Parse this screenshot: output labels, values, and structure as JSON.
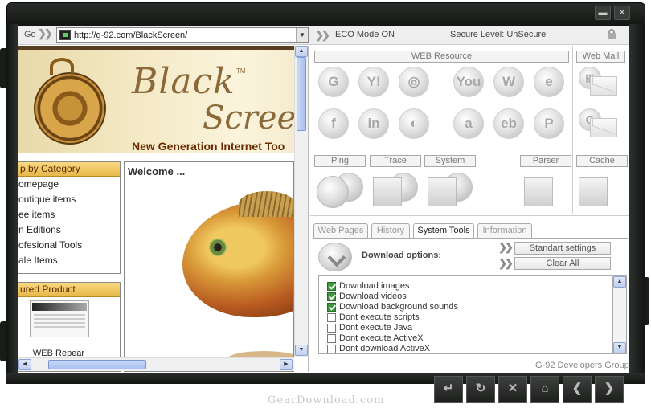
{
  "window": {
    "min_glyph": "▬",
    "close_glyph": "✕"
  },
  "navbar": {
    "go_label": "Go",
    "url": "http://g-92.com/BlackScreen/",
    "eco_mode": "ECO Mode ON",
    "security": "Secure Level: UnSecure"
  },
  "site": {
    "logo_top": "Black",
    "logo_tm": "TM",
    "logo_bottom": "Screen",
    "tagline": "New Generation Internet Too",
    "category_heading": "p by Category",
    "categories": [
      "omepage",
      "outique items",
      "ee items",
      "n Editions",
      "ofesional Tools",
      "ale Items"
    ],
    "featured_heading": "ured Product",
    "featured_name": "WEB Repear",
    "welcome": "Welcome ..."
  },
  "panel": {
    "web_resource_label": "WEB Resource",
    "web_mail_label": "Web Mail",
    "resource_icons": [
      {
        "icon": "google-icon",
        "glyph": "G"
      },
      {
        "icon": "yahoo-icon",
        "glyph": "Y!"
      },
      {
        "icon": "camera-icon",
        "glyph": "◎"
      },
      {
        "icon": "youtube-icon",
        "glyph": "You"
      },
      {
        "icon": "wordpress-icon",
        "glyph": "W"
      },
      {
        "icon": "explorer-icon",
        "glyph": "e"
      },
      {
        "icon": "facebook-icon",
        "glyph": "f"
      },
      {
        "icon": "linkedin-icon",
        "glyph": "in"
      },
      {
        "icon": "picasa-icon",
        "glyph": "◐"
      },
      {
        "icon": "amazon-icon",
        "glyph": "a"
      },
      {
        "icon": "ebay-icon",
        "glyph": "eb"
      },
      {
        "icon": "paypal-icon",
        "glyph": "P"
      }
    ],
    "mail_icons": [
      {
        "icon": "windows-mail-icon",
        "glyph": "⊞"
      },
      {
        "icon": "gmail-icon",
        "glyph": "G"
      }
    ],
    "ping_label": "Ping",
    "trace_label": "Trace",
    "system_label": "System",
    "parser_label": "Parser",
    "cache_label": "Cache",
    "tabs": [
      "Web Pages",
      "History",
      "System Tools",
      "Information"
    ],
    "download_options": "Download options:",
    "standart_settings": "Standart settings",
    "clear_all": "Clear All",
    "options": [
      {
        "label": "Download images",
        "checked": true
      },
      {
        "label": "Download videos",
        "checked": true
      },
      {
        "label": "Download background sounds",
        "checked": true
      },
      {
        "label": "Dont execute scripts",
        "checked": false
      },
      {
        "label": "Dont execute Java",
        "checked": false
      },
      {
        "label": "Dont execute ActiveX",
        "checked": false
      },
      {
        "label": "Dont download ActiveX",
        "checked": false
      }
    ],
    "footer": "G-92 Developers Group"
  },
  "bottom_nav": [
    "↵",
    "↻",
    "✕",
    "⌂",
    "❮",
    "❯"
  ],
  "watermark": "GearDownload.com"
}
